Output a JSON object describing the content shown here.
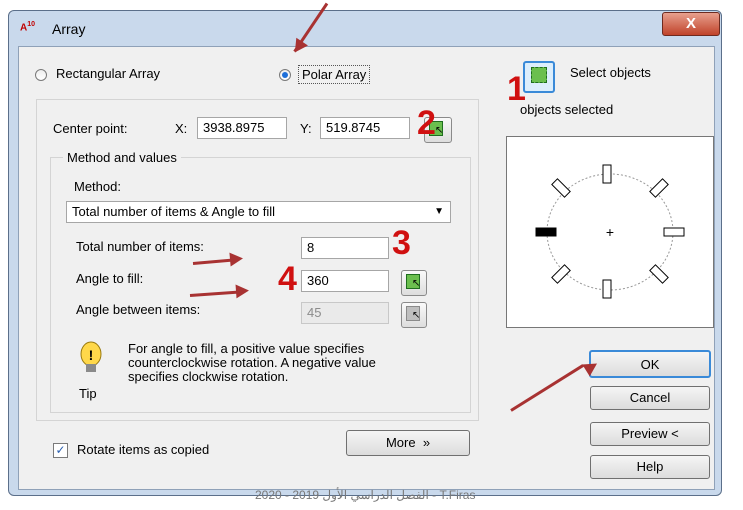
{
  "window": {
    "title": "Array",
    "close_label": "X"
  },
  "array_type": {
    "rectangular": "Rectangular Array",
    "polar": "Polar Array",
    "selected": "polar"
  },
  "select_objects": {
    "label": "Select objects",
    "status": "objects selected",
    "count": "1"
  },
  "center_point": {
    "label": "Center point:",
    "x_label": "X:",
    "x_value": "3938.8975",
    "y_label": "Y:",
    "y_value": "519.8745"
  },
  "method": {
    "group_label": "Method and values",
    "method_label": "Method:",
    "selected": "Total number of items & Angle to fill",
    "items_label": "Total number of items:",
    "items_value": "8",
    "angle_label": "Angle to fill:",
    "angle_value": "360",
    "between_label": "Angle between items:",
    "between_value": "45"
  },
  "tip": {
    "text": "For angle to fill, a positive value specifies counterclockwise rotation.  A negative value specifies clockwise rotation.",
    "label": "Tip"
  },
  "rotate_items": {
    "label": "Rotate items as copied",
    "checked": true
  },
  "buttons": {
    "more": "More",
    "ok": "OK",
    "cancel": "Cancel",
    "preview": "Preview <",
    "help": "Help"
  },
  "annotations": {
    "step2": "2",
    "step3": "3",
    "step4": "4"
  },
  "footer": "الفصل الدراسي الأول 2019 - 2020   -  T.Firas",
  "colors": {
    "annotation": "#d01010",
    "arrow": "#a83232",
    "title_bg": "#c9d9ec"
  }
}
